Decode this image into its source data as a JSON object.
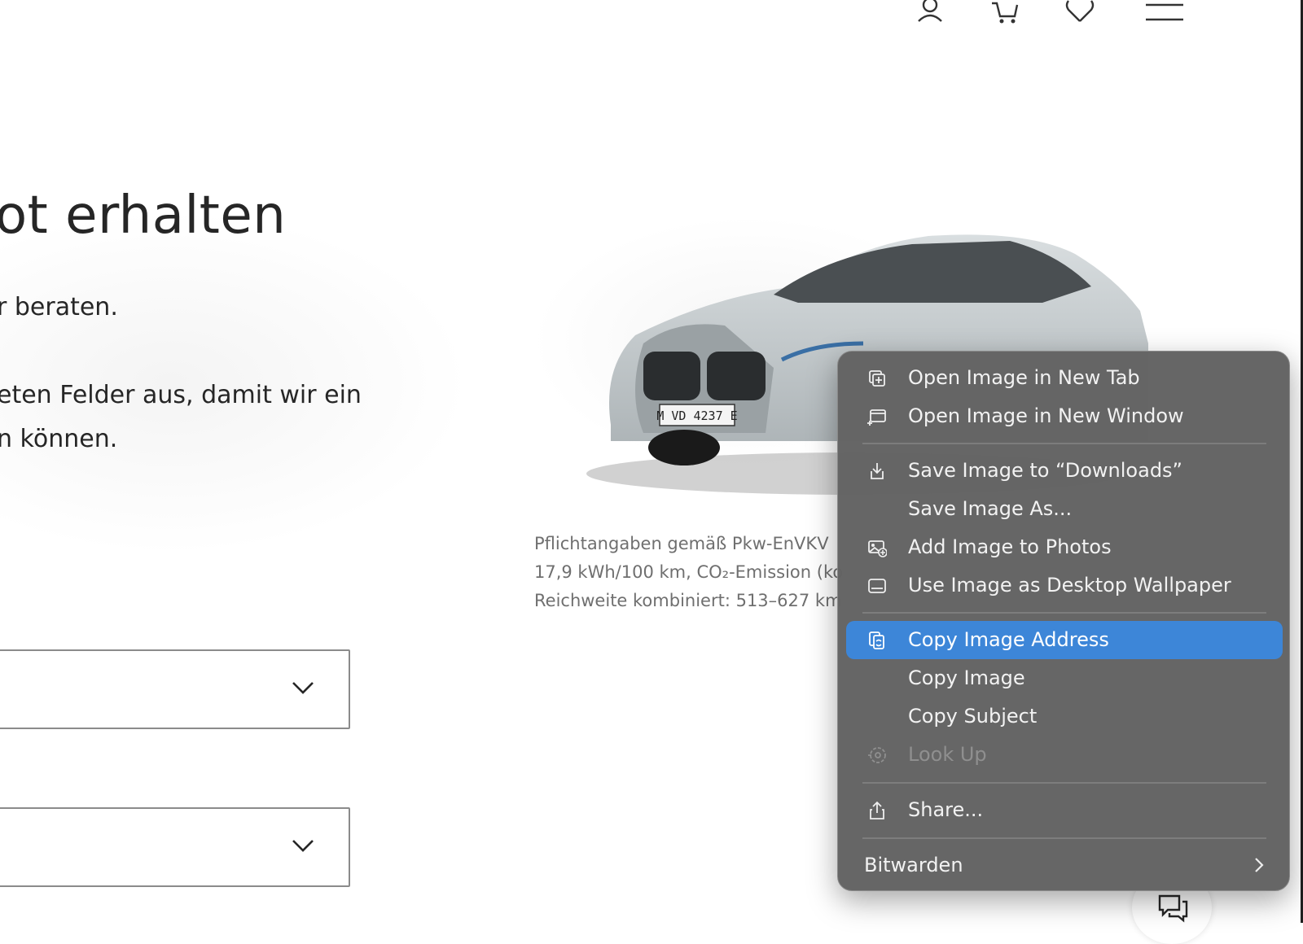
{
  "header": {
    "icons": [
      "user-icon",
      "cart-icon",
      "heart-icon",
      "menu-icon"
    ]
  },
  "hero": {
    "headline": "ot erhalten",
    "line1": "r beraten.",
    "line2": "eten Felder aus, damit wir ein",
    "line3": "n können."
  },
  "car": {
    "plate": "M VD 4237 E"
  },
  "disclaimer": {
    "line1": "Pflichtangaben gemäß Pkw-EnVKV",
    "line2": "17,9 kWh/100 km, CO₂-Emission (ko",
    "line3": "Reichweite kombiniert: 513–627 km"
  },
  "context_menu": {
    "items": [
      {
        "label": "Open Image in New Tab",
        "icon": "new-tab-icon",
        "state": "normal"
      },
      {
        "label": "Open Image in New Window",
        "icon": "new-window-icon",
        "state": "normal"
      },
      {
        "label": "Save Image to “Downloads”",
        "icon": "download-icon",
        "state": "normal"
      },
      {
        "label": "Save Image As...",
        "icon": "",
        "state": "normal"
      },
      {
        "label": "Add Image to Photos",
        "icon": "photos-icon",
        "state": "normal"
      },
      {
        "label": "Use Image as Desktop Wallpaper",
        "icon": "wallpaper-icon",
        "state": "normal"
      },
      {
        "label": "Copy Image Address",
        "icon": "copy-address-icon",
        "state": "highlighted"
      },
      {
        "label": "Copy Image",
        "icon": "",
        "state": "normal"
      },
      {
        "label": "Copy Subject",
        "icon": "",
        "state": "normal"
      },
      {
        "label": "Look Up",
        "icon": "look-up-icon",
        "state": "disabled"
      },
      {
        "label": "Share...",
        "icon": "share-icon",
        "state": "normal"
      },
      {
        "label": "Bitwarden",
        "icon": "chevron-right-icon",
        "state": "normal"
      }
    ],
    "highlight_color": "#3d86d8"
  },
  "colors": {
    "menu_bg": "#636363",
    "text_dark": "#262626",
    "disclaimer_text": "#6f6f6f"
  }
}
